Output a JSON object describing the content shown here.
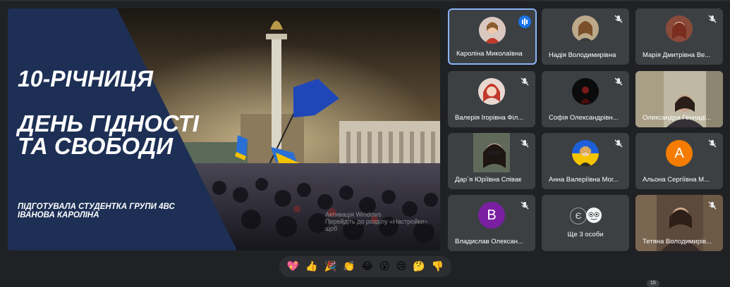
{
  "presentation": {
    "title_line1": "10-річниця",
    "title_line2": "День гідності та свободи",
    "byline_1": "Підготувала студентка групи 4ВС",
    "byline_2": "Іванова Кароліна",
    "watermark_1": "Активація Windows",
    "watermark_2": "Перейдіть до розділу «Настройки», щоб"
  },
  "participants": [
    {
      "name": "Кароліна Миколаївна",
      "speaking": true
    },
    {
      "name": "Надія Володимирівна",
      "muted": true
    },
    {
      "name": "Марія Дмитрівна Ве...",
      "muted": true
    },
    {
      "name": "Валерія Ігорівна Філ...",
      "muted": true
    },
    {
      "name": "Софія Олександрівн...",
      "muted": true
    },
    {
      "name": "Олександра Геннаді...",
      "muted": false
    },
    {
      "name": "Дар`я Юріївна Співак",
      "muted": true
    },
    {
      "name": "Анна Валеріївна Мог...",
      "muted": true
    },
    {
      "name": "Альона Сергіївна М...",
      "muted": true,
      "initial": "А",
      "color": "#f57c00"
    },
    {
      "name": "Владислав Олексан...",
      "muted": true,
      "initial": "В",
      "color": "#7b1fa2"
    },
    {
      "name": "Ще 3 особи",
      "initial": "Є",
      "color": "#3c4043"
    },
    {
      "name": "Тетяна Володимирів...",
      "muted": true
    }
  ],
  "reactions": [
    "💖",
    "👍",
    "🎉",
    "👏",
    "😂",
    "😮",
    "😢",
    "🤔",
    "👎"
  ],
  "reaction_count": "15",
  "colors": {
    "background": "#202124",
    "tile": "#3c4043",
    "active_border": "#8ab4f8",
    "panel": "#1d2f54"
  }
}
